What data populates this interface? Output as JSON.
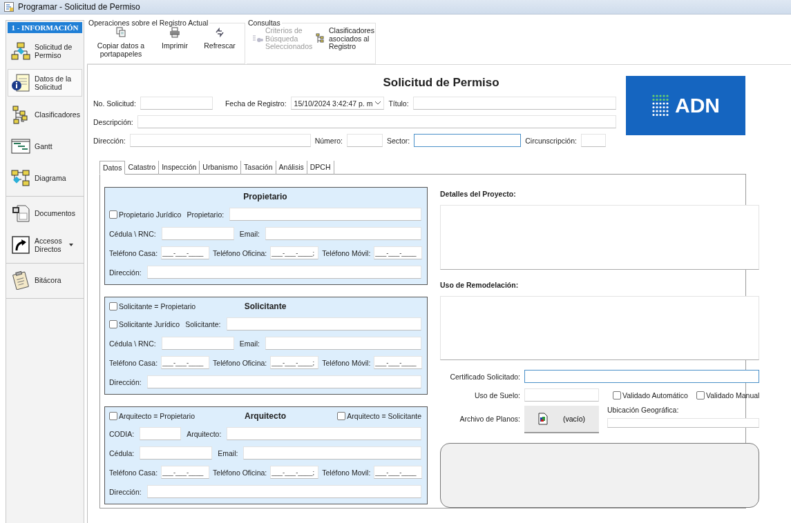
{
  "window": {
    "title": "Programar - Solicitud de Permiso"
  },
  "sidebar": {
    "header": "1 - INFORMACIÓN",
    "groups": [
      [
        {
          "label": "Solicitud de Permiso",
          "selected": false
        },
        {
          "label": "Datos de la Solicitud",
          "selected": true
        },
        {
          "label": "Clasificadores",
          "selected": false
        },
        {
          "label": "Gantt",
          "selected": false
        },
        {
          "label": "Diagrama",
          "selected": false
        }
      ],
      [
        {
          "label": "Documentos",
          "selected": false
        },
        {
          "label": "Accesos Directos",
          "selected": false,
          "has_menu": true
        }
      ],
      [
        {
          "label": "Bitácora",
          "selected": false
        }
      ]
    ]
  },
  "toolbar": {
    "groups": [
      {
        "title": "Operaciones sobre el Registro Actual",
        "buttons": [
          {
            "label": "Copiar datos a portapapeles",
            "disabled": false
          },
          {
            "label": "Imprimir",
            "disabled": false
          },
          {
            "label": "Refrescar",
            "disabled": false
          }
        ]
      },
      {
        "title": "Consultas",
        "buttons": [
          {
            "label": "Criterios de Búsqueda Seleccionados",
            "disabled": true
          },
          {
            "label": "Clasificadores asociados al Registro",
            "disabled": false
          }
        ]
      }
    ]
  },
  "form": {
    "title": "Solicitud de Permiso",
    "logo": {
      "text": "ADN"
    },
    "rows": [
      [
        {
          "label": "No. Solicitud:",
          "kind": "short"
        },
        {
          "label": "Fecha de Registro:",
          "kind": "date",
          "value": "15/10/2024 3:42:47 p. m"
        },
        {
          "label": "Título:",
          "kind": "wide"
        }
      ],
      [
        {
          "label": "Descripción:",
          "kind": "wide"
        }
      ],
      [
        {
          "label": "Dirección:",
          "kind": "long"
        },
        {
          "label": "Número:",
          "kind": "small"
        },
        {
          "label": "Sector:",
          "kind": "medium",
          "focused": true
        },
        {
          "label": "Circunscripción:",
          "kind": "tiny"
        }
      ]
    ]
  },
  "tabs": [
    {
      "label": "Datos",
      "selected": true
    },
    {
      "label": "Catastro",
      "selected": false
    },
    {
      "label": "Inspección",
      "selected": false
    },
    {
      "label": "Urbanismo",
      "selected": false
    },
    {
      "label": "Tasación",
      "selected": false
    },
    {
      "label": "Análisis",
      "selected": false
    },
    {
      "label": "DPCH",
      "selected": false
    }
  ],
  "sections": [
    {
      "title": "Propietario",
      "rows": [
        [
          {
            "kind": "check",
            "label": "Propietario Jurídico",
            "checked": false
          },
          {
            "kind": "wide",
            "label": "Propietario:"
          }
        ],
        [
          {
            "kind": "short",
            "label": "Cédula \\ RNC:"
          },
          {
            "kind": "wide",
            "label": "Email:"
          }
        ],
        [
          {
            "kind": "phone",
            "label": "Teléfono Casa:",
            "value": "___-___-____"
          },
          {
            "kind": "phone",
            "label": "Teléfono Oficina:",
            "value": "___-___-____;"
          },
          {
            "kind": "phone",
            "label": "Teléfono Móvil:",
            "value": "___-___-____"
          }
        ],
        [
          {
            "kind": "wide",
            "label": "Dirección:"
          }
        ]
      ]
    },
    {
      "title": "Solicitante",
      "header_left": {
        "label": "Solicitante = Propietario",
        "checked": false
      },
      "rows": [
        [
          {
            "kind": "check",
            "label": "Solicitante Jurídico",
            "checked": false
          },
          {
            "kind": "wide",
            "label": "Solicitante:"
          }
        ],
        [
          {
            "kind": "short",
            "label": "Cédula \\ RNC:"
          },
          {
            "kind": "wide",
            "label": "Email:"
          }
        ],
        [
          {
            "kind": "phone",
            "label": "Teléfono Casa:",
            "value": "___-___-____"
          },
          {
            "kind": "phone",
            "label": "Teléfono Oficina:",
            "value": "___-___-____;"
          },
          {
            "kind": "phone",
            "label": "Teléfono Móvil:",
            "value": "___-___-____"
          }
        ],
        [
          {
            "kind": "wide",
            "label": "Dirección:"
          }
        ]
      ]
    },
    {
      "title": "Arquitecto",
      "header_left": {
        "label": "Arquitecto = Propietario",
        "checked": false
      },
      "header_right": {
        "label": "Arquitecto = Solicitante",
        "checked": false
      },
      "rows": [
        [
          {
            "kind": "code",
            "label": "CODIA:"
          },
          {
            "kind": "wide",
            "label": "Arquitecto:"
          }
        ],
        [
          {
            "kind": "short",
            "label": "Cédula:"
          },
          {
            "kind": "wide",
            "label": "Email:"
          }
        ],
        [
          {
            "kind": "phone",
            "label": "Teléfono Casa:",
            "value": "___-___-____"
          },
          {
            "kind": "phone",
            "label": "Teléfono Oficina:",
            "value": "___-___-____;"
          },
          {
            "kind": "phone",
            "label": "Teléfono Movil:",
            "value": "___-___-____"
          }
        ],
        [
          {
            "kind": "wide",
            "label": "Dirección:"
          }
        ]
      ]
    }
  ],
  "project": {
    "details_label": "Detalles del Proyecto:",
    "remodel_label": "Uso de Remodelación:",
    "certificate": {
      "label": "Certificado Solicitado:",
      "focused": true
    },
    "land_use": {
      "label": "Uso de Suelo:"
    },
    "checks": [
      {
        "label": "Validado Automático",
        "checked": false
      },
      {
        "label": "Validado Manual",
        "checked": false
      }
    ],
    "plans": {
      "label": "Archivo de Planos:",
      "button": "(vacío)"
    },
    "location": {
      "label": "Ubicación Geográfica:"
    }
  }
}
